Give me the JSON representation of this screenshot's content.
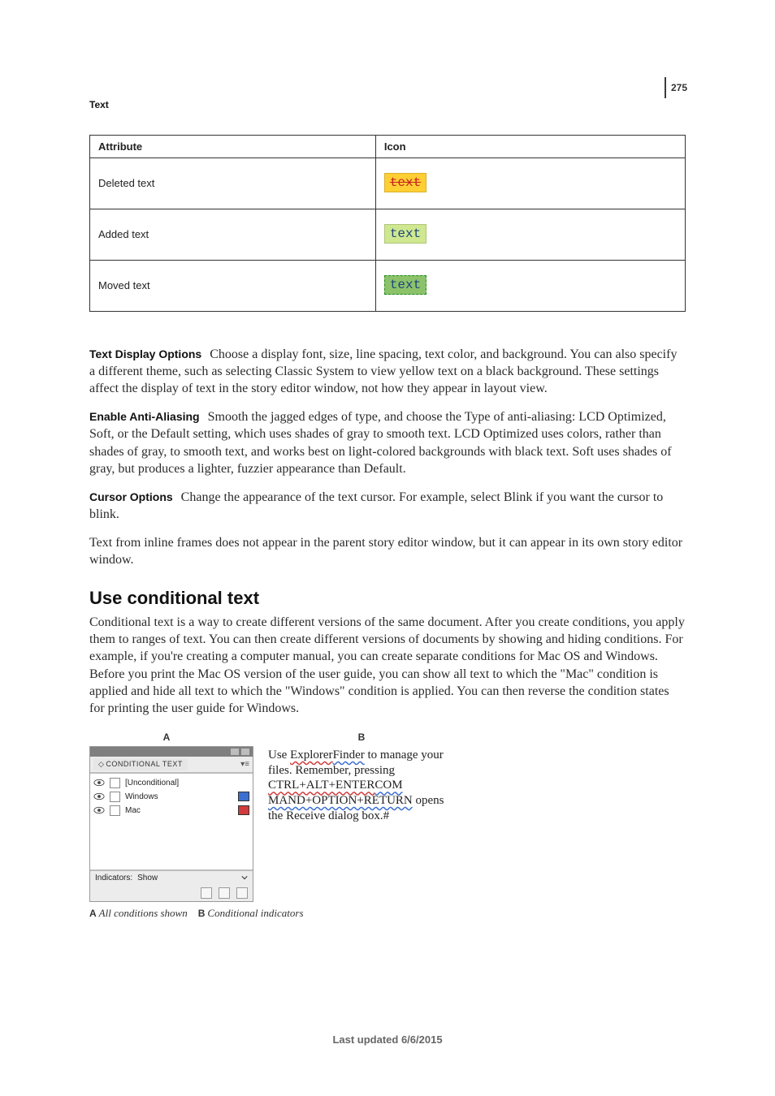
{
  "page_number": "275",
  "eyebrow": "Text",
  "table": {
    "headers": {
      "attr": "Attribute",
      "icon": "Icon"
    },
    "rows": [
      {
        "label": "Deleted text",
        "swatch_text": "text",
        "kind": "deleted"
      },
      {
        "label": "Added text",
        "swatch_text": "text",
        "kind": "added"
      },
      {
        "label": "Moved text",
        "swatch_text": "text",
        "kind": "moved"
      }
    ]
  },
  "paras": {
    "tdo_head": "Text Display Options",
    "tdo_body": "Choose a display font, size, line spacing, text color, and background. You can also specify a different theme, such as selecting Classic System to view yellow text on a black background. These settings affect the display of text in the story editor window, not how they appear in layout view.",
    "eaa_head": "Enable Anti-Aliasing",
    "eaa_body": "Smooth the jagged edges of type, and choose the Type of anti-aliasing: LCD Optimized, Soft, or the Default setting, which uses shades of gray to smooth text. LCD Optimized uses colors, rather than shades of gray, to smooth text, and works best on light-colored backgrounds with black text. Soft uses shades of gray, but produces a lighter, fuzzier appearance than Default.",
    "co_head": "Cursor Options",
    "co_body": "Change the appearance of the text cursor. For example, select Blink if you want the cursor to blink.",
    "inline_note": "Text from inline frames does not appear in the parent story editor window, but it can appear in its own story editor window."
  },
  "section_heading": "Use conditional text",
  "section_body": "Conditional text is a way to create different versions of the same document. After you create conditions, you apply them to ranges of text. You can then create different versions of documents by showing and hiding conditions. For example, if you're creating a computer manual, you can create separate conditions for Mac OS and Windows. Before you print the Mac OS version of the user guide, you can show all text to which the \"Mac\" condition is applied and hide all text to which the \"Windows\" condition is applied. You can then reverse the condition states for printing the user guide for Windows.",
  "figure": {
    "label_a": "A",
    "label_b": "B",
    "panel_title": "CONDITIONAL TEXT",
    "rows": {
      "unconditional": "[Unconditional]",
      "windows": "Windows",
      "mac": "Mac"
    },
    "indicators_label": "Indicators:",
    "indicators_value": "Show",
    "sample": {
      "l1a": "Use ",
      "l1b_red": "Explorer",
      "l1c_blue": "Finder",
      "l1d": " to manage",
      "l2": "your files. Remember, pressing",
      "l3_red": "CTRL+ALT+ENTER",
      "l3_blue": "COM",
      "l4_blue": "MAND+OPTION+RETURN",
      "l5": "opens the Receive dialog box.#"
    },
    "caption_a": "A",
    "caption_a_text": "All conditions shown",
    "caption_b": "B",
    "caption_b_text": "Conditional indicators"
  },
  "footer": "Last updated 6/6/2015"
}
